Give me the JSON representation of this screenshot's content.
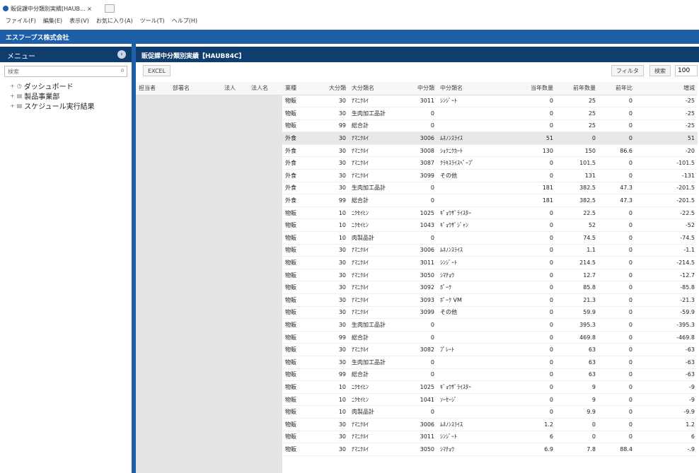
{
  "browser": {
    "tab_title": "販促課中分類別実績[HAUB... ×",
    "menu": [
      "ファイル(F)",
      "編集(E)",
      "表示(V)",
      "お気に入り(A)",
      "ツール(T)",
      "ヘルプ(H)"
    ]
  },
  "app": {
    "company": "エスフープス株式会社"
  },
  "sidebar": {
    "title": "メニュー",
    "search_placeholder": "検索",
    "items": [
      {
        "label": "ダッシュボード",
        "icon": "dashboard-icon"
      },
      {
        "label": "製品事業部",
        "icon": "folder-icon"
      },
      {
        "label": "スケジュール実行結果",
        "icon": "folder-icon"
      }
    ]
  },
  "main": {
    "title": "販促課中分類別実績【HAUB84C】",
    "excel_label": "EXCEL",
    "filter_label": "フィルタ",
    "search_label": "検索",
    "page_size": "100"
  },
  "table": {
    "columns": [
      "担当者",
      "部署名",
      "法人",
      "法人名",
      "業種",
      "大分類",
      "大分類名",
      "中分類",
      "中分類名",
      "当年数量",
      "前年数量",
      "前年比",
      "増減"
    ],
    "selected_row": 3,
    "rows": [
      [
        "物販",
        "30",
        "ﾅﾏﾆｸﾙｲ",
        "3011",
        "ｼﾝｼﾞｰﾄ",
        "0",
        "25",
        "0",
        "-25"
      ],
      [
        "物販",
        "30",
        "生肉加工品計",
        "0",
        "",
        "0",
        "25",
        "0",
        "-25"
      ],
      [
        "物販",
        "99",
        "総合計",
        "0",
        "",
        "0",
        "25",
        "0",
        "-25"
      ],
      [
        "外食",
        "30",
        "ﾅﾏﾆｸﾙｲ",
        "3006",
        "ﾑﾈﾉﾝｽﾗｲｽ",
        "51",
        "0",
        "0",
        "51"
      ],
      [
        "外食",
        "30",
        "ﾅﾏﾆｸﾙｲ",
        "3008",
        "ｼｮｸﾆｸｶｰﾄ",
        "130",
        "150",
        "86.6",
        "-20"
      ],
      [
        "外食",
        "30",
        "ﾅﾏﾆｸﾙｲ",
        "3087",
        "ｸﾗｷｽﾗｲｽﾍﾟｰﾌﾟ",
        "0",
        "101.5",
        "0",
        "-101.5"
      ],
      [
        "外食",
        "30",
        "ﾅﾏﾆｸﾙｲ",
        "3099",
        "その他",
        "0",
        "131",
        "0",
        "-131"
      ],
      [
        "外食",
        "30",
        "生肉加工品計",
        "0",
        "",
        "181",
        "382.5",
        "47.3",
        "-201.5"
      ],
      [
        "外食",
        "99",
        "総合計",
        "0",
        "",
        "181",
        "382.5",
        "47.3",
        "-201.5"
      ],
      [
        "物販",
        "10",
        "ﾆｸｾｲﾋﾝ",
        "1025",
        "ｷﾞｮｳｻﾞﾗｲｽﾀｰ",
        "0",
        "22.5",
        "0",
        "-22.5"
      ],
      [
        "物販",
        "10",
        "ﾆｸｾｲﾋﾝ",
        "1043",
        "ｷﾞｮｳｻﾞｼﾞｬﾝ",
        "0",
        "52",
        "0",
        "-52"
      ],
      [
        "物販",
        "10",
        "肉製品計",
        "0",
        "",
        "0",
        "74.5",
        "0",
        "-74.5"
      ],
      [
        "物販",
        "30",
        "ﾅﾏﾆｸﾙｲ",
        "3006",
        "ﾑﾈﾉﾝｽﾗｲｽ",
        "0",
        "1.1",
        "0",
        "-1.1"
      ],
      [
        "物販",
        "30",
        "ﾅﾏﾆｸﾙｲ",
        "3011",
        "ｼﾝｼﾞｰﾄ",
        "0",
        "214.5",
        "0",
        "-214.5"
      ],
      [
        "物販",
        "30",
        "ﾅﾏﾆｸﾙｲ",
        "3050",
        "ｼﾏﾁｮｳ",
        "0",
        "12.7",
        "0",
        "-12.7"
      ],
      [
        "物販",
        "30",
        "ﾅﾏﾆｸﾙｲ",
        "3092",
        "ﾎﾟｰｸ",
        "0",
        "85.8",
        "0",
        "-85.8"
      ],
      [
        "物販",
        "30",
        "ﾅﾏﾆｸﾙｲ",
        "3093",
        "ﾎﾟｰｸ VM",
        "0",
        "21.3",
        "0",
        "-21.3"
      ],
      [
        "物販",
        "30",
        "ﾅﾏﾆｸﾙｲ",
        "3099",
        "その他",
        "0",
        "59.9",
        "0",
        "-59.9"
      ],
      [
        "物販",
        "30",
        "生肉加工品計",
        "0",
        "",
        "0",
        "395.3",
        "0",
        "-395.3"
      ],
      [
        "物販",
        "99",
        "総合計",
        "0",
        "",
        "0",
        "469.8",
        "0",
        "-469.8"
      ],
      [
        "物販",
        "30",
        "ﾅﾏﾆｸﾙｲ",
        "3082",
        "ﾌﾟﾚｰﾄ",
        "0",
        "63",
        "0",
        "-63"
      ],
      [
        "物販",
        "30",
        "生肉加工品計",
        "0",
        "",
        "0",
        "63",
        "0",
        "-63"
      ],
      [
        "物販",
        "99",
        "総合計",
        "0",
        "",
        "0",
        "63",
        "0",
        "-63"
      ],
      [
        "物販",
        "10",
        "ﾆｸｾｲﾋﾝ",
        "1025",
        "ｷﾞｮｳｻﾞﾗｲｽﾀｰ",
        "0",
        "9",
        "0",
        "-9"
      ],
      [
        "物販",
        "10",
        "ﾆｸｾｲﾋﾝ",
        "1041",
        "ｿｰｾｰｼﾞ",
        "0",
        "9",
        "0",
        "-9"
      ],
      [
        "物販",
        "10",
        "肉製品計",
        "0",
        "",
        "0",
        "9.9",
        "0",
        "-9.9"
      ],
      [
        "物販",
        "30",
        "ﾅﾏﾆｸﾙｲ",
        "3006",
        "ﾑﾈﾉﾝｽﾗｲｽ",
        "1.2",
        "0",
        "0",
        "1.2"
      ],
      [
        "物販",
        "30",
        "ﾅﾏﾆｸﾙｲ",
        "3011",
        "ｼﾝｼﾞｰﾄ",
        "6",
        "0",
        "0",
        "6"
      ],
      [
        "物販",
        "30",
        "ﾅﾏﾆｸﾙｲ",
        "3050",
        "ｼﾏﾁｮｳ",
        "6.9",
        "7.8",
        "88.4",
        "-.9"
      ]
    ]
  }
}
